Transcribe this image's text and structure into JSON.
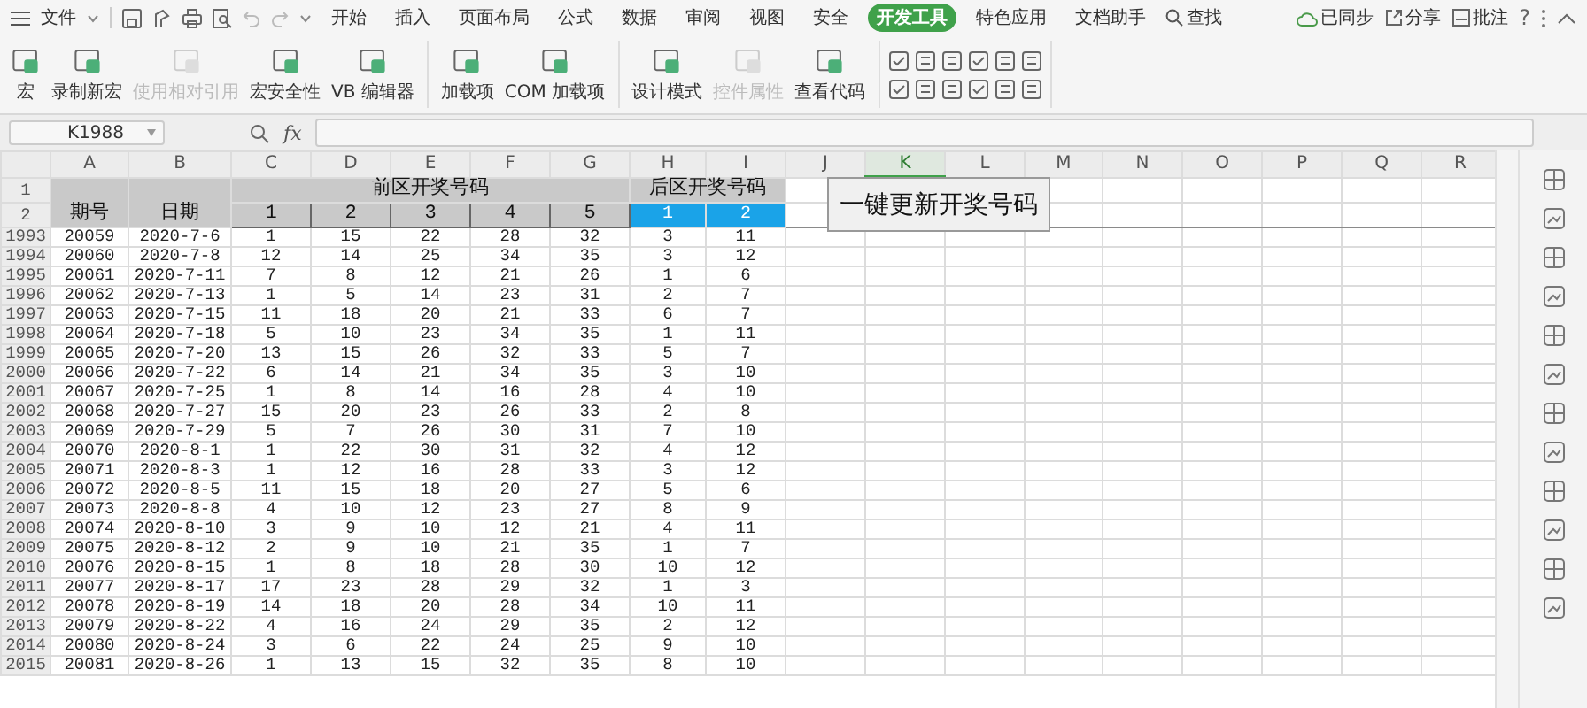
{
  "menu": {
    "file": "文件",
    "tabs": [
      {
        "label": "开始",
        "selected": false
      },
      {
        "label": "插入",
        "selected": false
      },
      {
        "label": "页面布局",
        "selected": false
      },
      {
        "label": "公式",
        "selected": false
      },
      {
        "label": "数据",
        "selected": false
      },
      {
        "label": "审阅",
        "selected": false
      },
      {
        "label": "视图",
        "selected": false
      },
      {
        "label": "安全",
        "selected": false
      },
      {
        "label": "开发工具",
        "selected": true
      },
      {
        "label": "特色应用",
        "selected": false
      },
      {
        "label": "文档助手",
        "selected": false
      }
    ],
    "search": "查找",
    "sync": "已同步",
    "share": "分享",
    "comment": "批注",
    "help": "?"
  },
  "ribbon": {
    "buttons": [
      {
        "label": "宏",
        "disabled": false
      },
      {
        "label": "录制新宏",
        "disabled": false
      },
      {
        "label": "使用相对引用",
        "disabled": true
      },
      {
        "label": "宏安全性",
        "disabled": false
      },
      {
        "label": "VB 编辑器",
        "disabled": false
      },
      {
        "label": "加载项",
        "disabled": false
      },
      {
        "label": "COM 加载项",
        "disabled": false
      },
      {
        "label": "设计模式",
        "disabled": false
      },
      {
        "label": "控件属性",
        "disabled": true
      },
      {
        "label": "查看代码",
        "disabled": false
      }
    ]
  },
  "formula_bar": {
    "name_box": "K1988",
    "fx": "fx"
  },
  "sheet": {
    "columns": [
      {
        "label": "A",
        "selected": false
      },
      {
        "label": "B",
        "selected": false
      },
      {
        "label": "C",
        "selected": false
      },
      {
        "label": "D",
        "selected": false
      },
      {
        "label": "E",
        "selected": false
      },
      {
        "label": "F",
        "selected": false
      },
      {
        "label": "G",
        "selected": false
      },
      {
        "label": "H",
        "selected": false
      },
      {
        "label": "I",
        "selected": false
      },
      {
        "label": "J",
        "selected": false
      },
      {
        "label": "K",
        "selected": true
      },
      {
        "label": "L",
        "selected": false
      },
      {
        "label": "M",
        "selected": false
      },
      {
        "label": "N",
        "selected": false
      },
      {
        "label": "O",
        "selected": false
      },
      {
        "label": "P",
        "selected": false
      },
      {
        "label": "Q",
        "selected": false
      },
      {
        "label": "R",
        "selected": false
      }
    ],
    "header_rows": {
      "row_numbers": [
        "1",
        "2"
      ],
      "issue": "期号",
      "date": "日期",
      "front_title": "前区开奖号码",
      "back_title": "后区开奖号码",
      "front_numbers": [
        "1",
        "2",
        "3",
        "4",
        "5"
      ],
      "back_numbers": [
        "1",
        "2"
      ]
    },
    "rows": [
      {
        "number": "1993",
        "cells": [
          "20059",
          "2020-7-6",
          "1",
          "15",
          "22",
          "28",
          "32",
          "3",
          "11"
        ]
      },
      {
        "number": "1994",
        "cells": [
          "20060",
          "2020-7-8",
          "12",
          "14",
          "25",
          "34",
          "35",
          "3",
          "12"
        ]
      },
      {
        "number": "1995",
        "cells": [
          "20061",
          "2020-7-11",
          "7",
          "8",
          "12",
          "21",
          "26",
          "1",
          "6"
        ]
      },
      {
        "number": "1996",
        "cells": [
          "20062",
          "2020-7-13",
          "1",
          "5",
          "14",
          "23",
          "31",
          "2",
          "7"
        ]
      },
      {
        "number": "1997",
        "cells": [
          "20063",
          "2020-7-15",
          "11",
          "18",
          "20",
          "21",
          "33",
          "6",
          "7"
        ]
      },
      {
        "number": "1998",
        "cells": [
          "20064",
          "2020-7-18",
          "5",
          "10",
          "23",
          "34",
          "35",
          "1",
          "11"
        ]
      },
      {
        "number": "1999",
        "cells": [
          "20065",
          "2020-7-20",
          "13",
          "15",
          "26",
          "32",
          "33",
          "5",
          "7"
        ]
      },
      {
        "number": "2000",
        "cells": [
          "20066",
          "2020-7-22",
          "6",
          "14",
          "21",
          "34",
          "35",
          "3",
          "10"
        ]
      },
      {
        "number": "2001",
        "cells": [
          "20067",
          "2020-7-25",
          "1",
          "8",
          "14",
          "16",
          "28",
          "4",
          "10"
        ]
      },
      {
        "number": "2002",
        "cells": [
          "20068",
          "2020-7-27",
          "15",
          "20",
          "23",
          "26",
          "33",
          "2",
          "8"
        ]
      },
      {
        "number": "2003",
        "cells": [
          "20069",
          "2020-7-29",
          "5",
          "7",
          "26",
          "30",
          "31",
          "7",
          "10"
        ]
      },
      {
        "number": "2004",
        "cells": [
          "20070",
          "2020-8-1",
          "1",
          "22",
          "30",
          "31",
          "32",
          "4",
          "12"
        ]
      },
      {
        "number": "2005",
        "cells": [
          "20071",
          "2020-8-3",
          "1",
          "12",
          "16",
          "28",
          "33",
          "3",
          "12"
        ]
      },
      {
        "number": "2006",
        "cells": [
          "20072",
          "2020-8-5",
          "11",
          "15",
          "18",
          "20",
          "27",
          "5",
          "6"
        ]
      },
      {
        "number": "2007",
        "cells": [
          "20073",
          "2020-8-8",
          "4",
          "10",
          "12",
          "23",
          "27",
          "8",
          "9"
        ]
      },
      {
        "number": "2008",
        "cells": [
          "20074",
          "2020-8-10",
          "3",
          "9",
          "10",
          "12",
          "21",
          "4",
          "11"
        ]
      },
      {
        "number": "2009",
        "cells": [
          "20075",
          "2020-8-12",
          "2",
          "9",
          "10",
          "21",
          "35",
          "1",
          "7"
        ]
      },
      {
        "number": "2010",
        "cells": [
          "20076",
          "2020-8-15",
          "1",
          "8",
          "18",
          "28",
          "30",
          "10",
          "12"
        ]
      },
      {
        "number": "2011",
        "cells": [
          "20077",
          "2020-8-17",
          "17",
          "23",
          "28",
          "29",
          "32",
          "1",
          "3"
        ]
      },
      {
        "number": "2012",
        "cells": [
          "20078",
          "2020-8-19",
          "14",
          "18",
          "20",
          "28",
          "34",
          "10",
          "11"
        ]
      },
      {
        "number": "2013",
        "cells": [
          "20079",
          "2020-8-22",
          "4",
          "16",
          "24",
          "29",
          "35",
          "2",
          "12"
        ]
      },
      {
        "number": "2014",
        "cells": [
          "20080",
          "2020-8-24",
          "3",
          "6",
          "22",
          "24",
          "25",
          "9",
          "10"
        ]
      },
      {
        "number": "2015",
        "cells": [
          "20081",
          "2020-8-26",
          "1",
          "13",
          "15",
          "32",
          "35",
          "8",
          "10"
        ]
      }
    ]
  },
  "macro_button": "一键更新开奖号码"
}
